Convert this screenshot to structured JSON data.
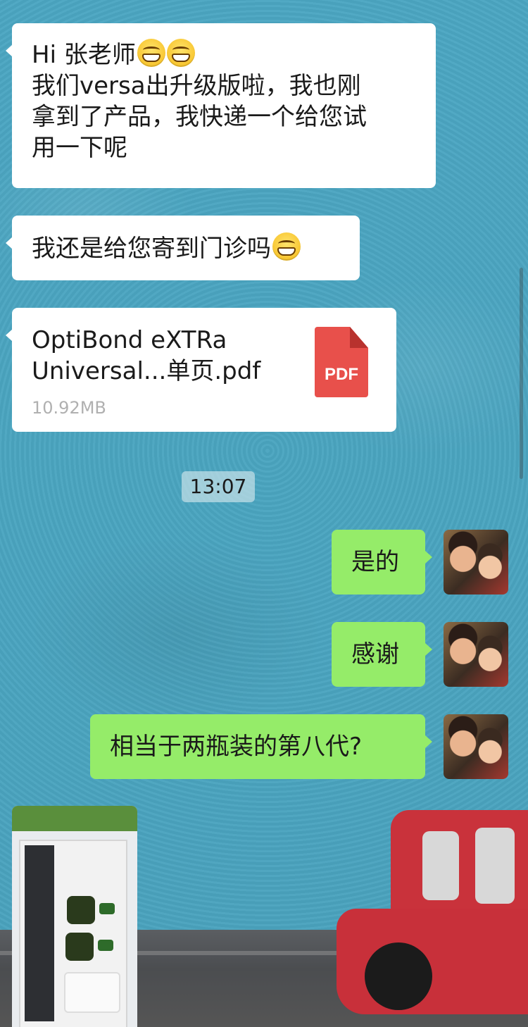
{
  "messages": [
    {
      "side": "left",
      "type": "text",
      "lines": [
        "Hi  张老师",
        "我们versa出升级版啦，我也刚",
        "拿到了产品，我快递一个给您试",
        "用一下呢"
      ],
      "emoji": "grin-emoji"
    },
    {
      "side": "left",
      "type": "text",
      "text": "我还是给您寄到门诊吗",
      "emoji": "grin-emoji"
    },
    {
      "side": "left",
      "type": "file",
      "file_name_line1": "OptiBond eXTRa",
      "file_name_line2": "Universal...单页.pdf",
      "file_size": "10.92MB",
      "file_type_label": "PDF"
    },
    {
      "side": "right",
      "type": "text",
      "text": "是的"
    },
    {
      "side": "right",
      "type": "text",
      "text": "感谢"
    },
    {
      "side": "right",
      "type": "text",
      "text": "相当于两瓶装的第八代?"
    },
    {
      "side": "left",
      "type": "image",
      "subject": "product-photo"
    }
  ],
  "timestamp": "13:07",
  "colors": {
    "incoming_bubble": "#ffffff",
    "outgoing_bubble": "#95ec69",
    "pdf_icon": "#e8504b",
    "chat_background": "#4aa5c0"
  }
}
